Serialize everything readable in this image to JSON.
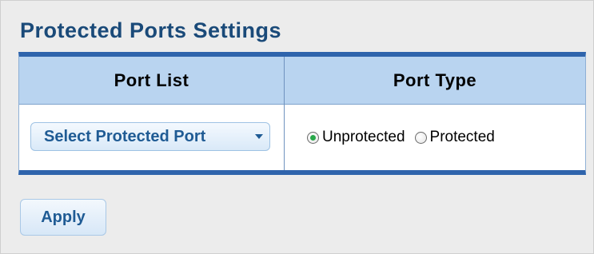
{
  "page": {
    "title": "Protected Ports Settings"
  },
  "table": {
    "headers": {
      "port_list": "Port List",
      "port_type": "Port Type"
    },
    "row": {
      "port_select": {
        "selected_value": "Select Protected Port",
        "icon": "chevron-down-icon"
      },
      "port_type_options": [
        {
          "label": "Unprotected",
          "checked": true
        },
        {
          "label": "Protected",
          "checked": false
        }
      ]
    }
  },
  "actions": {
    "apply_label": "Apply"
  },
  "colors": {
    "title": "#1a4a79",
    "table_border": "#2f64ac",
    "header_bg": "#b9d4f0",
    "button_text": "#1f5b94",
    "radio_checked": "#29a84a"
  }
}
